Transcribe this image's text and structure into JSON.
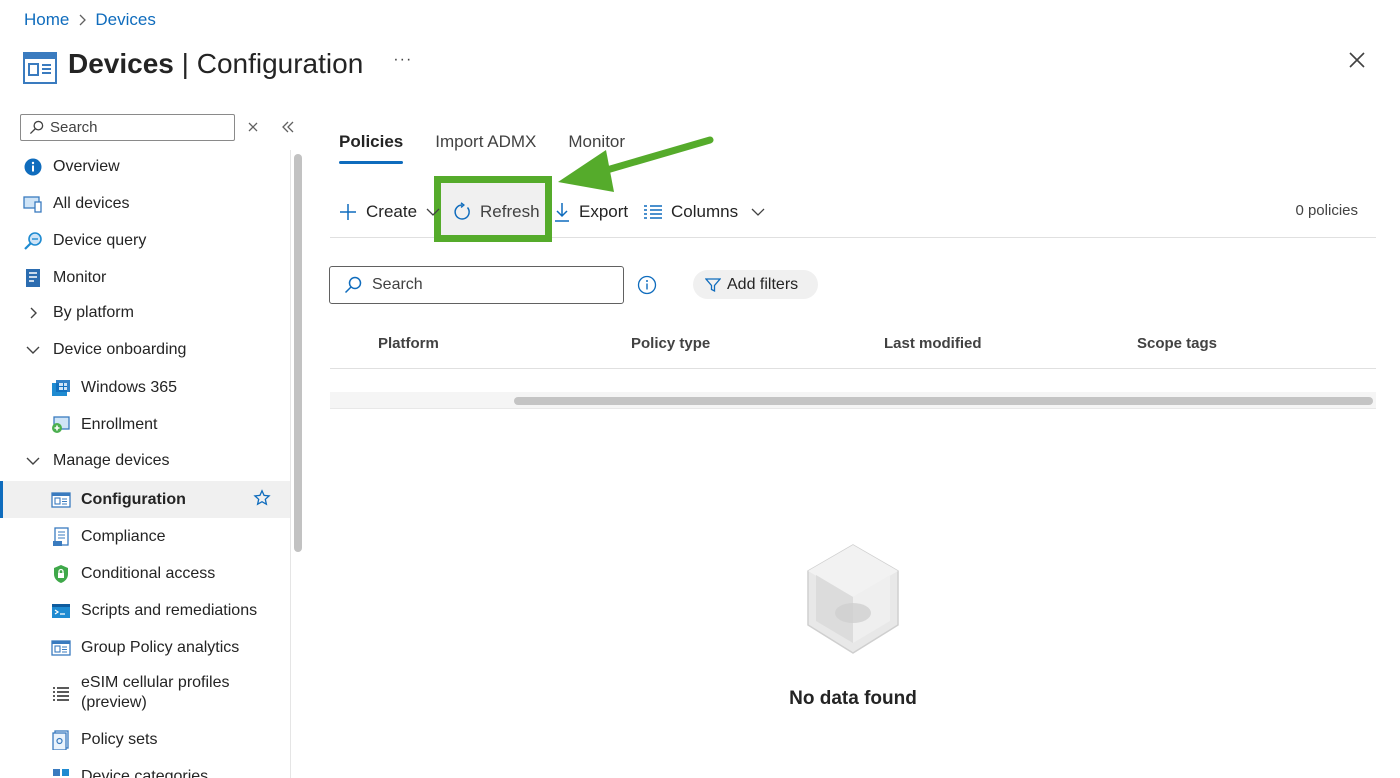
{
  "breadcrumb": {
    "home": "Home",
    "devices": "Devices"
  },
  "header": {
    "title_bold": "Devices",
    "title_sep": " | ",
    "title_rest": "Configuration",
    "more": "···"
  },
  "sidebar": {
    "search_placeholder": "Search",
    "items": [
      {
        "label": "Overview",
        "icon": "info-icon"
      },
      {
        "label": "All devices",
        "icon": "devices-icon"
      },
      {
        "label": "Device query",
        "icon": "query-icon"
      },
      {
        "label": "Monitor",
        "icon": "monitor-icon"
      },
      {
        "label": "By platform",
        "icon": "chevron-right-icon"
      },
      {
        "label": "Device onboarding",
        "icon": "chevron-down-icon"
      },
      {
        "label": "Windows 365",
        "icon": "windows365-icon"
      },
      {
        "label": "Enrollment",
        "icon": "enrollment-icon"
      },
      {
        "label": "Manage devices",
        "icon": "chevron-down-icon"
      },
      {
        "label": "Configuration",
        "icon": "configuration-icon"
      },
      {
        "label": "Compliance",
        "icon": "compliance-icon"
      },
      {
        "label": "Conditional access",
        "icon": "shield-icon"
      },
      {
        "label": "Scripts and remediations",
        "icon": "scripts-icon"
      },
      {
        "label": "Group Policy analytics",
        "icon": "group-policy-icon"
      },
      {
        "label": "eSIM cellular profiles (preview)",
        "line1": "eSIM cellular profiles",
        "line2": "(preview)",
        "icon": "list-icon"
      },
      {
        "label": "Policy sets",
        "icon": "policy-sets-icon"
      },
      {
        "label": "Device categories",
        "icon": "categories-icon"
      }
    ]
  },
  "tabs": [
    "Policies",
    "Import ADMX",
    "Monitor"
  ],
  "toolbar": {
    "create": "Create",
    "refresh": "Refresh",
    "export": "Export",
    "columns": "Columns",
    "policy_count": "0 policies"
  },
  "search": {
    "placeholder": "Search"
  },
  "filters": {
    "add_label": "Add filters"
  },
  "table": {
    "columns": [
      "Platform",
      "Policy type",
      "Last modified",
      "Scope tags"
    ]
  },
  "empty_state": {
    "message": "No data found"
  },
  "colors": {
    "accent": "#0f6cbd",
    "highlight": "#55ab2b"
  }
}
